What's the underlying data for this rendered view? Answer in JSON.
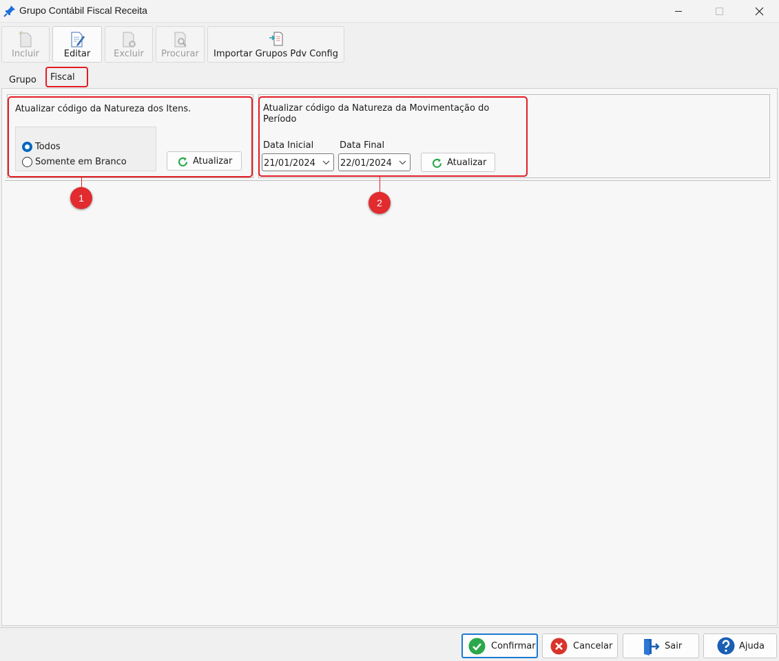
{
  "window": {
    "title": "Grupo Contábil Fiscal Receita"
  },
  "toolbar": {
    "incluir": "Incluir",
    "editar": "Editar",
    "excluir": "Excluir",
    "procurar": "Procurar",
    "importar": "Importar Grupos Pdv Config"
  },
  "tabs": {
    "grupo": "Grupo",
    "fiscal": "Fiscal"
  },
  "section1": {
    "title": "Atualizar  código da Natureza dos Itens.",
    "option_all": "Todos",
    "option_blank": "Somente em Branco",
    "selected": "Todos",
    "update_button": "Atualizar"
  },
  "section2": {
    "title_line1": "Atualizar  código da Natureza da Movimentação do",
    "title_line2": "Período",
    "start_label": "Data Inicial",
    "end_label": "Data Final",
    "start_value": "21/01/2024",
    "end_value": "22/01/2024",
    "update_button": "Atualizar"
  },
  "markers": {
    "one": "1",
    "two": "2"
  },
  "footer": {
    "confirmar": "Confirmar",
    "cancelar": "Cancelar",
    "sair": "Sair",
    "ajuda": "Ajuda"
  },
  "colors": {
    "highlight": "#e31b23",
    "accent": "#0067c0",
    "confirm_green": "#2aa84a",
    "cancel_red": "#d9342b",
    "help_blue": "#1a5fb4"
  },
  "icons": {
    "title": "pushpin-icon",
    "incluir": "new-document-icon",
    "editar": "edit-document-icon",
    "excluir": "delete-document-icon",
    "procurar": "search-document-icon",
    "importar": "import-icon",
    "refresh": "refresh-icon",
    "confirmar": "check-circle-icon",
    "cancelar": "x-circle-icon",
    "sair": "exit-door-icon",
    "ajuda": "help-icon"
  }
}
